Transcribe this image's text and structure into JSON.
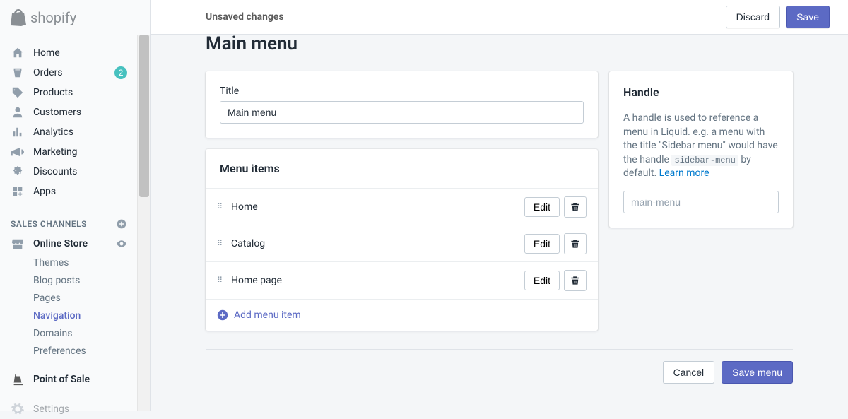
{
  "logo": "shopify",
  "topbar": {
    "status": "Unsaved changes",
    "discard": "Discard",
    "save": "Save"
  },
  "sidebar": {
    "home": "Home",
    "orders": "Orders",
    "orders_badge": "2",
    "products": "Products",
    "customers": "Customers",
    "analytics": "Analytics",
    "marketing": "Marketing",
    "discounts": "Discounts",
    "apps": "Apps",
    "sales_channels": "SALES CHANNELS",
    "online_store": "Online Store",
    "themes": "Themes",
    "blog_posts": "Blog posts",
    "pages": "Pages",
    "navigation": "Navigation",
    "domains": "Domains",
    "preferences": "Preferences",
    "point_of_sale": "Point of Sale",
    "settings": "Settings"
  },
  "page": {
    "title": "Main menu",
    "title_label": "Title",
    "title_value": "Main menu",
    "menu_items_header": "Menu items",
    "add_menu_item": "Add menu item",
    "edit": "Edit",
    "items": [
      {
        "label": "Home"
      },
      {
        "label": "Catalog"
      },
      {
        "label": "Home page"
      }
    ]
  },
  "handle": {
    "title": "Handle",
    "desc_1": "A handle is used to reference a menu in Liquid. e.g. a menu with the title \"Sidebar menu\" would have the handle ",
    "code": "sidebar-menu",
    "desc_2": " by default. ",
    "learn_more": "Learn more",
    "placeholder": "main-menu"
  },
  "footer": {
    "cancel": "Cancel",
    "save_menu": "Save menu"
  }
}
